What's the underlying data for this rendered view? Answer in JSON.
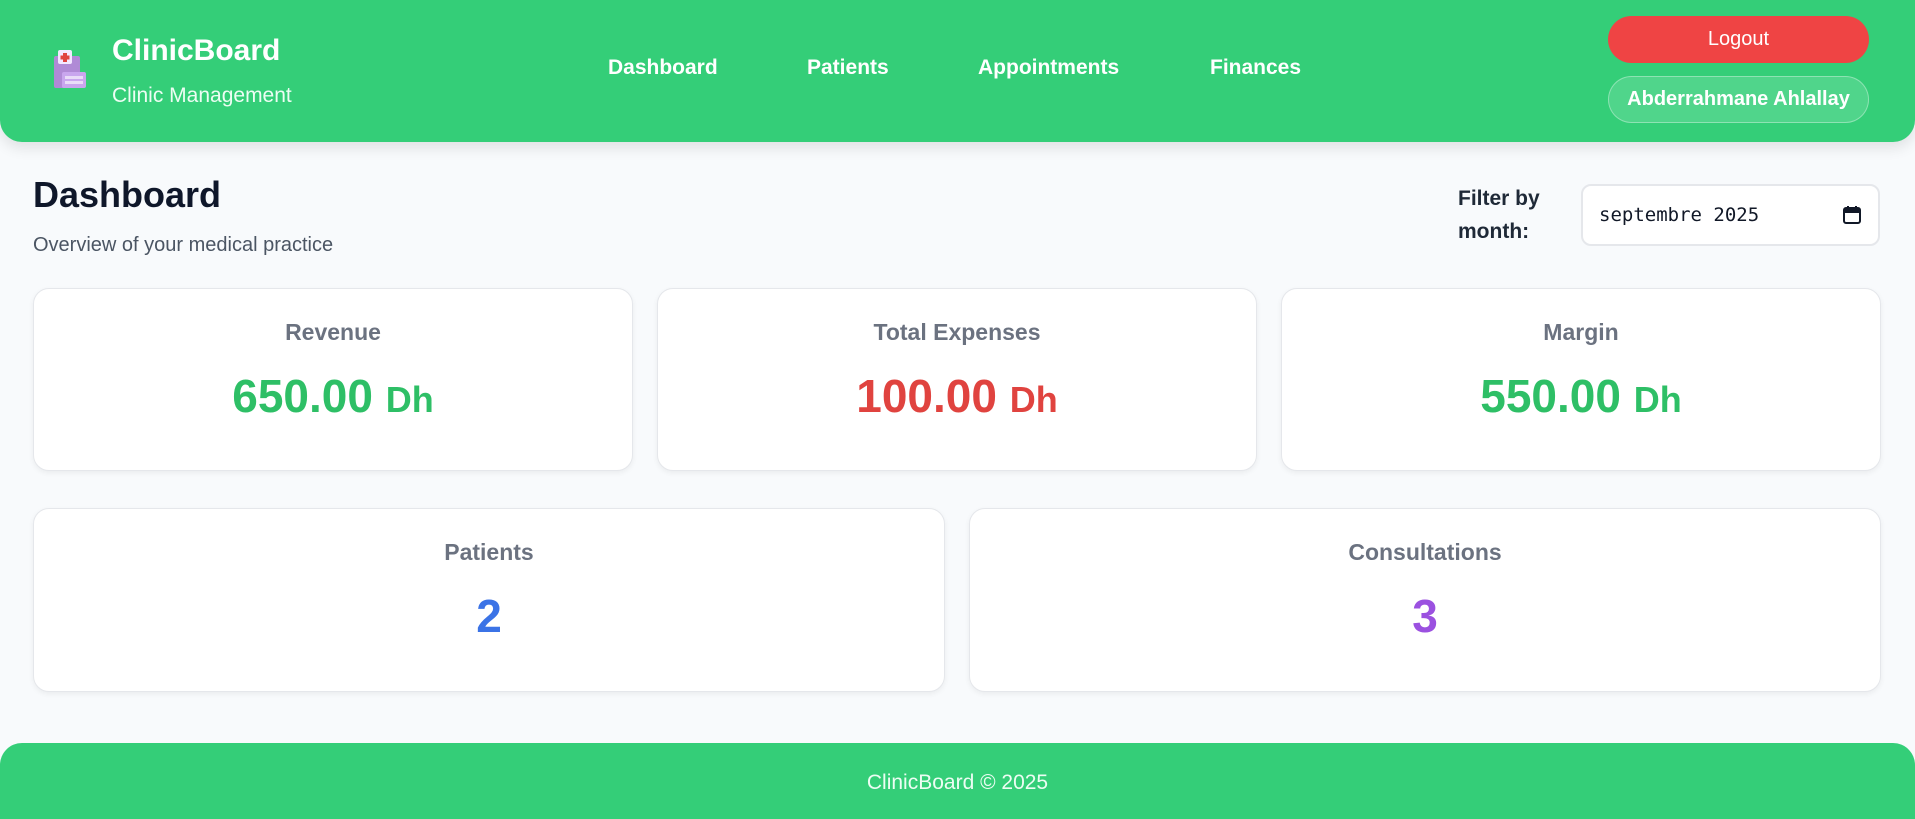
{
  "header": {
    "brand_title": "ClinicBoard",
    "brand_subtitle": "Clinic Management",
    "brand_icon": "clinic-building-icon",
    "nav": [
      {
        "label": "Dashboard"
      },
      {
        "label": "Patients"
      },
      {
        "label": "Appointments"
      },
      {
        "label": "Finances"
      }
    ],
    "logout_label": "Logout",
    "user_name": "Abderrahmane Ahlallay"
  },
  "page": {
    "title": "Dashboard",
    "subtitle": "Overview of your medical practice",
    "filter_label": "Filter by month:",
    "filter_value": "septembre 2025"
  },
  "stats": {
    "revenue": {
      "label": "Revenue",
      "value": "650.00",
      "unit": "Dh",
      "color": "#2ebf66"
    },
    "expenses": {
      "label": "Total Expenses",
      "value": "100.00",
      "unit": "Dh",
      "color": "#e0433f"
    },
    "margin": {
      "label": "Margin",
      "value": "550.00",
      "unit": "Dh",
      "color": "#2ebf66"
    },
    "patients": {
      "label": "Patients",
      "value": "2",
      "color": "#3b73e6"
    },
    "consultations": {
      "label": "Consultations",
      "value": "3",
      "color": "#9b51e0"
    }
  },
  "footer": {
    "text": "ClinicBoard © 2025"
  },
  "colors": {
    "header_bg": "#34ce78",
    "logout_bg": "#ef4444",
    "page_bg": "#f8fafc"
  }
}
